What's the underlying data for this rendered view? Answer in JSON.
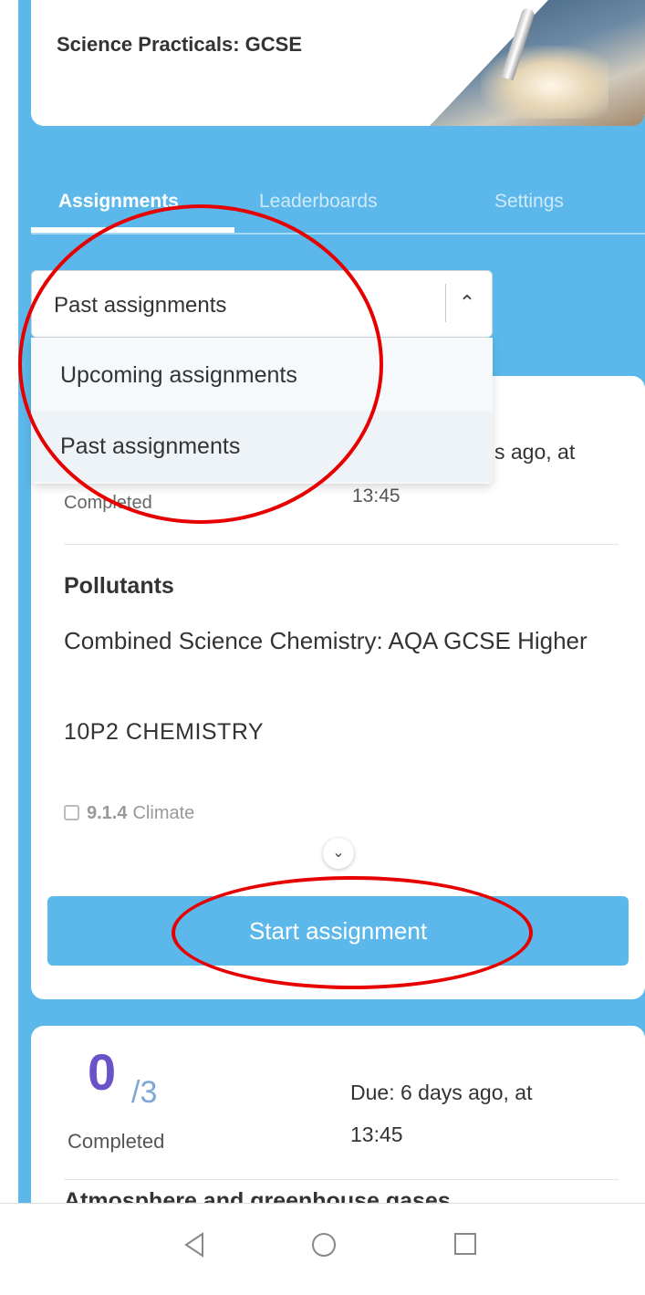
{
  "header": {
    "course_title": "Science Practicals: GCSE"
  },
  "tabs": [
    {
      "label": "Assignments",
      "active": true
    },
    {
      "label": "Leaderboards",
      "active": false
    },
    {
      "label": "Settings",
      "active": false
    }
  ],
  "filter": {
    "selected": "Past assignments",
    "options": [
      "Upcoming assignments",
      "Past assignments"
    ]
  },
  "assignment1": {
    "due_partial": "s ago, at",
    "due_time": "13:45",
    "completed_label": "Completed",
    "title": "Pollutants",
    "course": "Combined Science Chemistry: AQA GCSE Higher",
    "class_name": "10P2 CHEMISTRY",
    "topic_code": "9.1.4",
    "topic_name": "Climate",
    "start_label": "Start assignment"
  },
  "assignment2": {
    "completed_count": "0",
    "total": "3",
    "completed_label": "Completed",
    "due_text": "Due: 6 days ago, at",
    "due_time": "13:45",
    "title": "Atmosphere and greenhouse gases"
  },
  "navbar": {
    "back_icon": "triangle-back",
    "home_icon": "circle-home",
    "recents_icon": "square-recents"
  },
  "colors": {
    "primary": "#5cb8ea",
    "annotation": "#e60000",
    "progress": "#6a53c9"
  }
}
